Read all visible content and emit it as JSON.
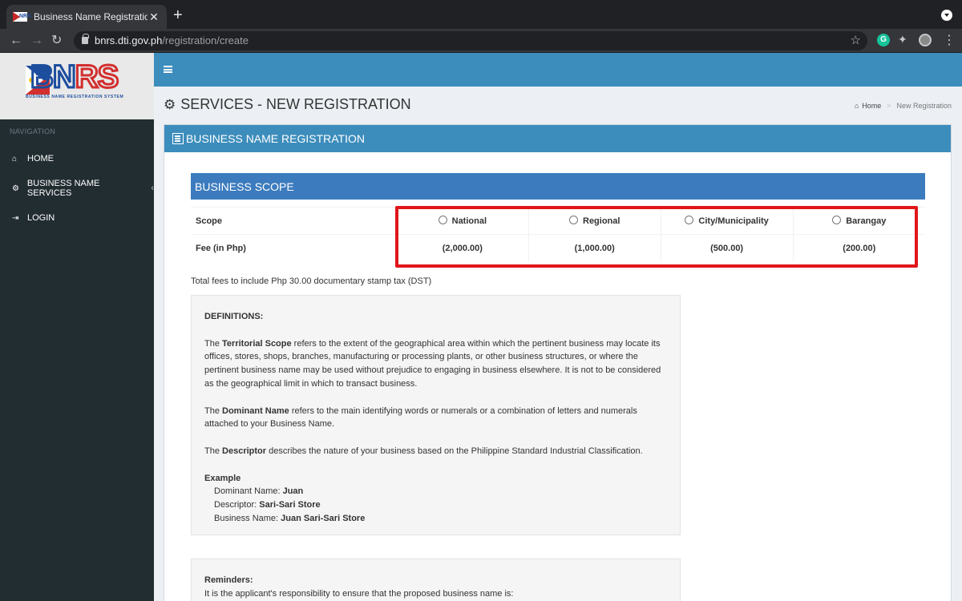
{
  "browser": {
    "tab_title": "Business Name Registration - D",
    "url_host": "bnrs.dti.gov.ph",
    "url_path": "/registration/create",
    "extension_letter": "G"
  },
  "sidebar": {
    "logo_text": "BNRS",
    "logo_subtitle": "BUSINESS NAME REGISTRATION SYSTEM",
    "nav_header": "NAVIGATION",
    "items": [
      {
        "label": "HOME",
        "icon": "home-icon"
      },
      {
        "label": "BUSINESS NAME SERVICES",
        "icon": "gears-icon",
        "chevron": "‹"
      },
      {
        "label": "LOGIN",
        "icon": "sign-in-icon"
      }
    ]
  },
  "header": {
    "page_title": "SERVICES - NEW REGISTRATION",
    "breadcrumb": {
      "home": "Home",
      "current": "New Registration"
    }
  },
  "panel": {
    "title": "BUSINESS NAME REGISTRATION",
    "scope_section_title": "BUSINESS SCOPE",
    "scope_row_label": "Scope",
    "fee_row_label": "Fee (in Php)",
    "options": [
      {
        "label": "National",
        "fee": "(2,000.00)"
      },
      {
        "label": "Regional",
        "fee": "(1,000.00)"
      },
      {
        "label": "City/Municipality",
        "fee": "(500.00)"
      },
      {
        "label": "Barangay",
        "fee": "(200.00)"
      }
    ],
    "fees_note": "Total fees to include Php 30.00 documentary stamp tax (DST)",
    "definitions": {
      "heading": "DEFINITIONS:",
      "p1_pre": "The ",
      "p1_term": "Territorial Scope",
      "p1_post": " refers to the extent of the geographical area within which the pertinent business may locate its offices, stores, shops, branches, manufacturing or processing plants, or other business structures, or where the pertinent business name may be used without prejudice to engaging in business elsewhere. It is not to be considered as the geographical limit in which to transact business.",
      "p2_pre": "The ",
      "p2_term": "Dominant Name",
      "p2_post": " refers to the main identifying words or numerals or a combination of letters and numerals attached to your Business Name.",
      "p3_pre": "The ",
      "p3_term": "Descriptor",
      "p3_post": " describes the nature of your business based on the Philippine Standard Industrial Classification.",
      "example_heading": "Example",
      "ex1_label": "Dominant Name: ",
      "ex1_value": "Juan",
      "ex2_label": "Descriptor: ",
      "ex2_value": "Sari-Sari Store",
      "ex3_label": "Business Name: ",
      "ex3_value": "Juan Sari-Sari Store"
    },
    "reminders": {
      "heading": "Reminders:",
      "line1": "It is the applicant's responsibility to ensure that the proposed business name is:"
    }
  },
  "colors": {
    "accent": "#3c8dbc",
    "sidebar_bg": "#222d32",
    "highlight": "#e0171b"
  }
}
